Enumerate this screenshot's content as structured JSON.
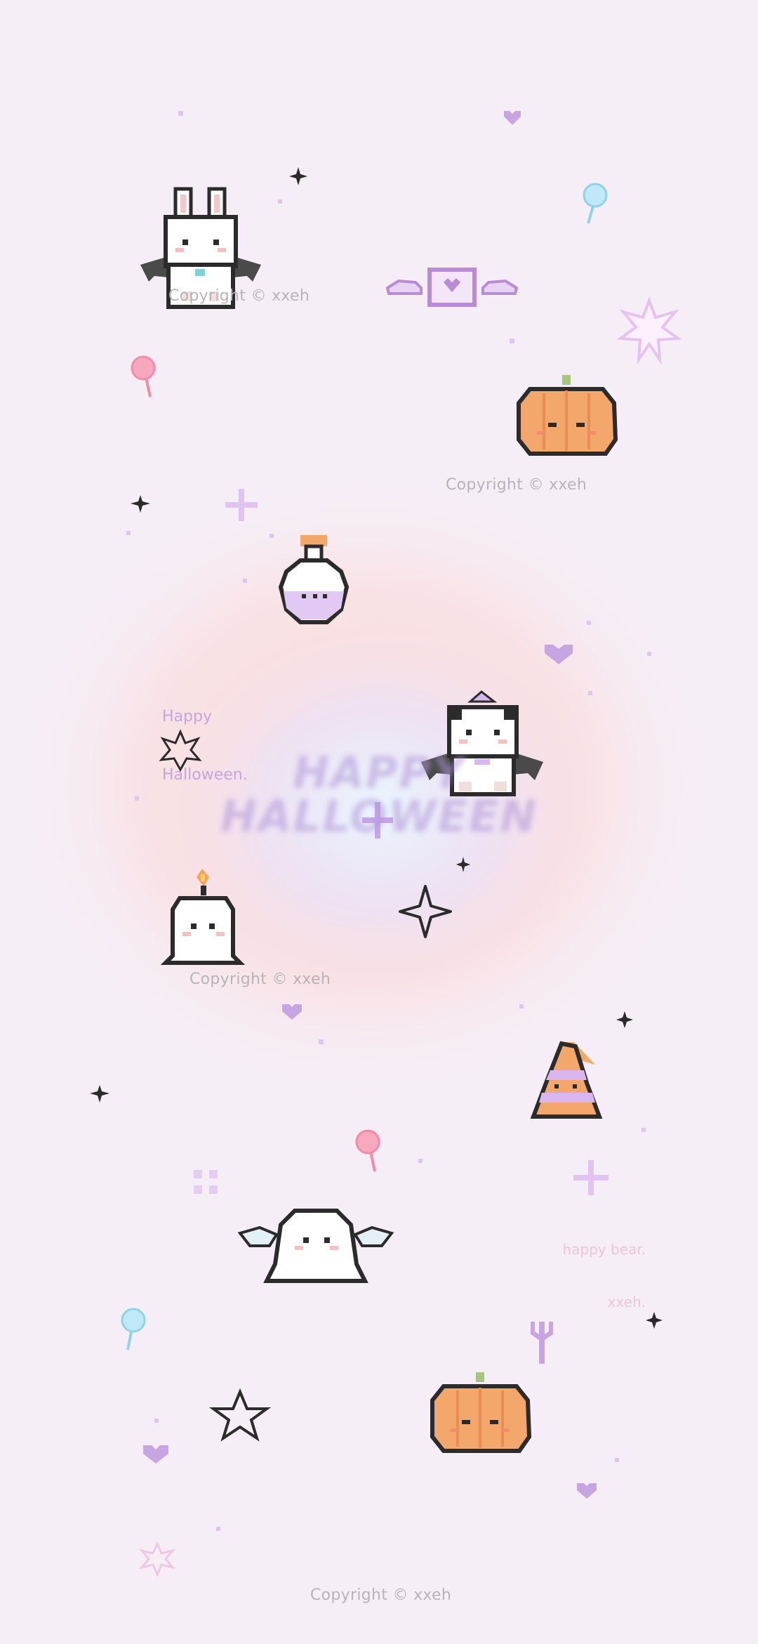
{
  "wallpaper": {
    "theme": "pixel halloween",
    "colors": {
      "background": "#f6eef7",
      "glow_pink": "#f8d9d6",
      "glow_blue": "#e6f1ff",
      "accent_purple": "#c7a4e2",
      "pumpkin_orange": "#f4a76b",
      "outline": "#2b2b2b"
    },
    "copyright_marks": [
      "Copyright © xxeh",
      "Copyright © xxeh",
      "Copyright © xxeh",
      "Copyright © xxeh"
    ],
    "note_happy_halloween": [
      "Happy",
      "Halloween."
    ],
    "note_happy_bear": [
      "happy bear.",
      "xxeh."
    ],
    "glow_title": [
      "HAPPY",
      "HALLOWEEN"
    ],
    "stickers": [
      "bunny-with-bat-wings",
      "winged-heart-box",
      "pumpkin",
      "potion-bottle",
      "bear-with-bat-wings",
      "candle-ghost",
      "witch-hat",
      "winged-ghost",
      "pumpkin",
      "trident",
      "lollipops",
      "sparkles",
      "hearts"
    ]
  }
}
